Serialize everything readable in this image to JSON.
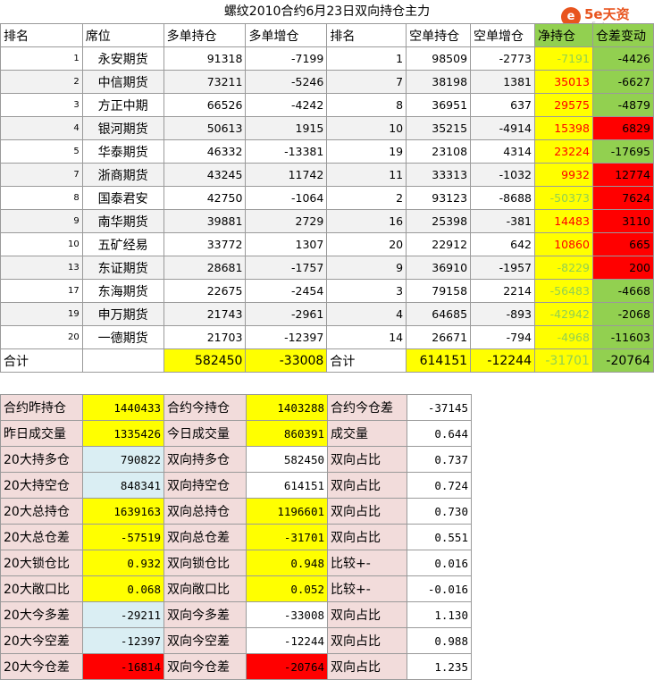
{
  "title": "螺纹2010合约6月23日双向持仓主力",
  "logo": {
    "brand": "5e天资",
    "mark": "e",
    "url": "5etz.com"
  },
  "headers": [
    "排名",
    "席位",
    "多单持仓",
    "多单增仓",
    "排名",
    "空单持仓",
    "空单增仓",
    "净持仓",
    "仓差变动"
  ],
  "rows": [
    {
      "rank_long": "1",
      "seat": "永安期货",
      "long": "91318",
      "long_chg": "-7199",
      "rank_short": "1",
      "short": "98509",
      "short_chg": "-2773",
      "net": "-7191",
      "diff": "-4426"
    },
    {
      "rank_long": "2",
      "seat": "中信期货",
      "long": "73211",
      "long_chg": "-5246",
      "rank_short": "7",
      "short": "38198",
      "short_chg": "1381",
      "net": "35013",
      "diff": "-6627"
    },
    {
      "rank_long": "3",
      "seat": "方正中期",
      "long": "66526",
      "long_chg": "-4242",
      "rank_short": "8",
      "short": "36951",
      "short_chg": "637",
      "net": "29575",
      "diff": "-4879"
    },
    {
      "rank_long": "4",
      "seat": "银河期货",
      "long": "50613",
      "long_chg": "1915",
      "rank_short": "10",
      "short": "35215",
      "short_chg": "-4914",
      "net": "15398",
      "diff": "6829"
    },
    {
      "rank_long": "5",
      "seat": "华泰期货",
      "long": "46332",
      "long_chg": "-13381",
      "rank_short": "19",
      "short": "23108",
      "short_chg": "4314",
      "net": "23224",
      "diff": "-17695"
    },
    {
      "rank_long": "7",
      "seat": "浙商期货",
      "long": "43245",
      "long_chg": "11742",
      "rank_short": "11",
      "short": "33313",
      "short_chg": "-1032",
      "net": "9932",
      "diff": "12774"
    },
    {
      "rank_long": "8",
      "seat": "国泰君安",
      "long": "42750",
      "long_chg": "-1064",
      "rank_short": "2",
      "short": "93123",
      "short_chg": "-8688",
      "net": "-50373",
      "diff": "7624"
    },
    {
      "rank_long": "9",
      "seat": "南华期货",
      "long": "39881",
      "long_chg": "2729",
      "rank_short": "16",
      "short": "25398",
      "short_chg": "-381",
      "net": "14483",
      "diff": "3110"
    },
    {
      "rank_long": "10",
      "seat": "五矿经易",
      "long": "33772",
      "long_chg": "1307",
      "rank_short": "20",
      "short": "22912",
      "short_chg": "642",
      "net": "10860",
      "diff": "665"
    },
    {
      "rank_long": "13",
      "seat": "东证期货",
      "long": "28681",
      "long_chg": "-1757",
      "rank_short": "9",
      "short": "36910",
      "short_chg": "-1957",
      "net": "-8229",
      "diff": "200"
    },
    {
      "rank_long": "17",
      "seat": "东海期货",
      "long": "22675",
      "long_chg": "-2454",
      "rank_short": "3",
      "short": "79158",
      "short_chg": "2214",
      "net": "-56483",
      "diff": "-4668"
    },
    {
      "rank_long": "19",
      "seat": "申万期货",
      "long": "21743",
      "long_chg": "-2961",
      "rank_short": "4",
      "short": "64685",
      "short_chg": "-893",
      "net": "-42942",
      "diff": "-2068"
    },
    {
      "rank_long": "20",
      "seat": "一德期货",
      "long": "21703",
      "long_chg": "-12397",
      "rank_short": "14",
      "short": "26671",
      "short_chg": "-794",
      "net": "-4968",
      "diff": "-11603"
    }
  ],
  "totals": {
    "label_left": "合计",
    "long": "582450",
    "long_chg": "-33008",
    "label_right": "合计",
    "short": "614151",
    "short_chg": "-12244",
    "net": "-31701",
    "diff": "-20764"
  },
  "stats": [
    {
      "l1": "合约昨持仓",
      "v1": "1440433",
      "c1": "y",
      "l2": "合约今持仓",
      "v2": "1403288",
      "c2": "y",
      "l3": "合约今仓差",
      "v3": "-37145"
    },
    {
      "l1": "昨日成交量",
      "v1": "1335426",
      "c1": "y",
      "l2": "今日成交量",
      "v2": "860391",
      "c2": "y",
      "l3": "成交量",
      "v3": "0.644"
    },
    {
      "l1": "20大持多仓",
      "v1": "790822",
      "c1": "blue",
      "l2": "双向持多仓",
      "v2": "582450",
      "c2": "w",
      "l3": "双向占比",
      "v3": "0.737"
    },
    {
      "l1": "20大持空仓",
      "v1": "848341",
      "c1": "blue",
      "l2": "双向持空仓",
      "v2": "614151",
      "c2": "w",
      "l3": "双向占比",
      "v3": "0.724"
    },
    {
      "l1": "20大总持仓",
      "v1": "1639163",
      "c1": "y",
      "l2": "双向总持仓",
      "v2": "1196601",
      "c2": "y",
      "l3": "双向占比",
      "v3": "0.730"
    },
    {
      "l1": "20大总仓差",
      "v1": "-57519",
      "c1": "y",
      "l2": "双向总仓差",
      "v2": "-31701",
      "c2": "y",
      "l3": "双向占比",
      "v3": "0.551"
    },
    {
      "l1": "20大锁仓比",
      "v1": "0.932",
      "c1": "y",
      "l2": "双向锁仓比",
      "v2": "0.948",
      "c2": "y",
      "l3": "比较+-",
      "v3": "0.016"
    },
    {
      "l1": "20大敞口比",
      "v1": "0.068",
      "c1": "y",
      "l2": "双向敞口比",
      "v2": "0.052",
      "c2": "y",
      "l3": "比较+-",
      "v3": "-0.016"
    },
    {
      "l1": "20大今多差",
      "v1": "-29211",
      "c1": "blue",
      "l2": "双向今多差",
      "v2": "-33008",
      "c2": "w",
      "l3": "双向占比",
      "v3": "1.130"
    },
    {
      "l1": "20大今空差",
      "v1": "-12397",
      "c1": "blue",
      "l2": "双向今空差",
      "v2": "-12244",
      "c2": "w",
      "l3": "双向占比",
      "v3": "0.988"
    },
    {
      "l1": "20大今仓差",
      "v1": "-16814",
      "c1": "r",
      "l2": "双向今仓差",
      "v2": "-20764",
      "c2": "r",
      "l3": "双向占比",
      "v3": "1.235"
    }
  ],
  "colors": {
    "yellow": "#ffff00",
    "green": "#92d050",
    "red": "#ff0000",
    "pink": "#f2dcdb",
    "light_blue": "#daeef3"
  }
}
